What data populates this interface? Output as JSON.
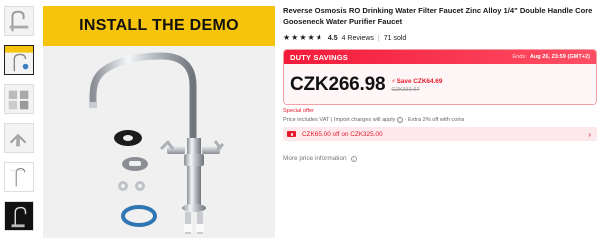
{
  "gallery": {
    "banner_text": "INSTALL THE DEMO",
    "thumbnails": [
      "faucet-photo",
      "install-demo",
      "faucet-parts",
      "faucet-closeup",
      "faucet-diagram",
      "faucet-dark"
    ]
  },
  "product": {
    "title": "Reverse Osmosis RO Drinking Water Filter Faucet Zinc Alloy 1/4\" Double Handle Core Gooseneck Water Purifier Faucet",
    "rating_score": "4.5",
    "rating_stars": 4.5,
    "reviews": "4 Reviews",
    "sold": "71 sold"
  },
  "deal": {
    "label": "DUTY SAVINGS",
    "ends_prefix": "Ends",
    "ends_value": "Aug 26, 23:59 (GMT+2)",
    "price": "CZK266.98",
    "save": "Save CZK64.69",
    "original_price": "CZK331.67"
  },
  "special_offer": "Special offer",
  "vat_note": "Price includes VAT | Import charges will apply",
  "extra_note": " · Extra 2% off with coins",
  "coupon": {
    "text": "CZK65.00 off on CZK325.00"
  },
  "more_price_info": "More price information",
  "colors": {
    "accent_red": "#e8192c",
    "banner_yellow": "#f6c40a"
  }
}
